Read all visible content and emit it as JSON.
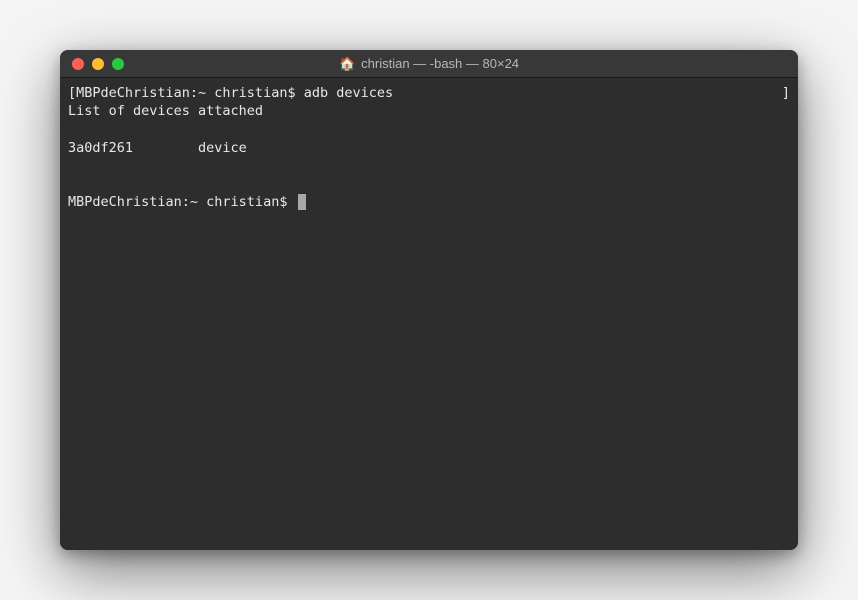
{
  "window": {
    "title": "christian — -bash — 80×24",
    "icon": "🏠"
  },
  "terminal": {
    "lines": [
      "[MBPdeChristian:~ christian$ adb devices",
      "List of devices attached",
      "3a0df261        device",
      "",
      "MBPdeChristian:~ christian$ "
    ],
    "rightBracket": "]"
  }
}
